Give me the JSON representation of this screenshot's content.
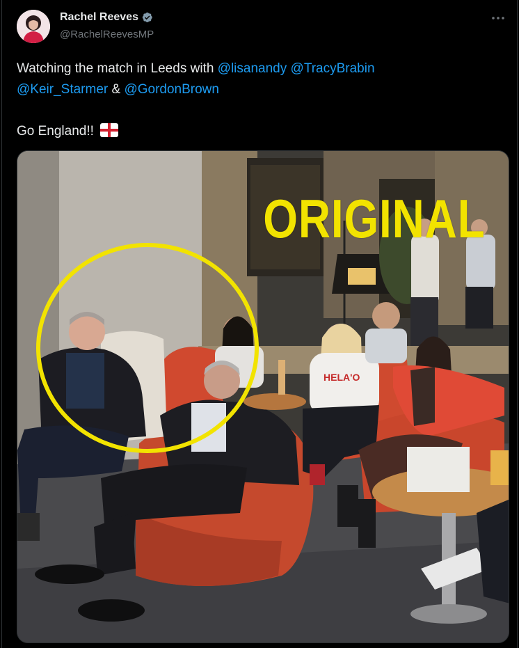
{
  "author": {
    "display_name": "Rachel Reeves",
    "handle": "@RachelReevesMP",
    "verified": true,
    "avatar_icon": "profile-avatar"
  },
  "menu": {
    "more_icon": "more-horizontal-icon"
  },
  "tweet": {
    "line1_text": "Watching the match in Leeds with ",
    "mention_lisanandy": "@lisanandy",
    "mention_tracybrabin": "@TracyBrabin",
    "mention_keir": "@Keir_Starmer",
    "amp": " & ",
    "mention_gordon": "@GordonBrown",
    "line3_text": "Go England!! ",
    "flag_icon": "england-flag-icon"
  },
  "media": {
    "watermark_text": "ORIGINAL",
    "highlight_color": "#f2e300"
  },
  "colors": {
    "background": "#000000",
    "text": "#e7e9ea",
    "secondary": "#71767b",
    "link": "#1d9bf0",
    "verified": "#829aab"
  }
}
